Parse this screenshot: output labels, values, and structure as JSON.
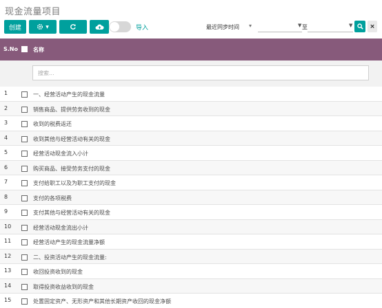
{
  "page": {
    "title": "现金流量项目"
  },
  "toolbar": {
    "create_label": "创建",
    "gear_icon": "gear-icon",
    "refresh_icon": "refresh-icon",
    "upload_icon": "cloud-upload-icon",
    "import_label": "导入",
    "sync_label": "最近同步时间",
    "to_label": "至",
    "clear_label": "×"
  },
  "colors": {
    "accent": "#00a09d",
    "header": "#875a7b"
  },
  "table": {
    "headers": {
      "sno": "S.No",
      "name": "名称"
    },
    "search_placeholder": "搜索...",
    "rows": [
      {
        "num": "1",
        "name": "一、经营活动产生的现金流量"
      },
      {
        "num": "2",
        "name": "销售商品、提供劳务收到的现金"
      },
      {
        "num": "3",
        "name": "收到的税费返还"
      },
      {
        "num": "4",
        "name": "收到其他与经营活动有关的现金"
      },
      {
        "num": "5",
        "name": "经营活动现金流入小计"
      },
      {
        "num": "6",
        "name": "购买商品、接受劳务支付的现金"
      },
      {
        "num": "7",
        "name": "支付给职工以及为职工支付的现金"
      },
      {
        "num": "8",
        "name": "支付的各项税费"
      },
      {
        "num": "9",
        "name": "支付其他与经营活动有关的现金"
      },
      {
        "num": "10",
        "name": "经营活动现金流出小计"
      },
      {
        "num": "11",
        "name": "经营活动产生的现金流量净额"
      },
      {
        "num": "12",
        "name": "二、投资活动产生的现金流量:"
      },
      {
        "num": "13",
        "name": "收回投资收到的现金"
      },
      {
        "num": "14",
        "name": "取得投资收益收到的现金"
      },
      {
        "num": "15",
        "name": "处置固定资产、无形资产和其他长期资产收回的现金净额"
      }
    ]
  }
}
